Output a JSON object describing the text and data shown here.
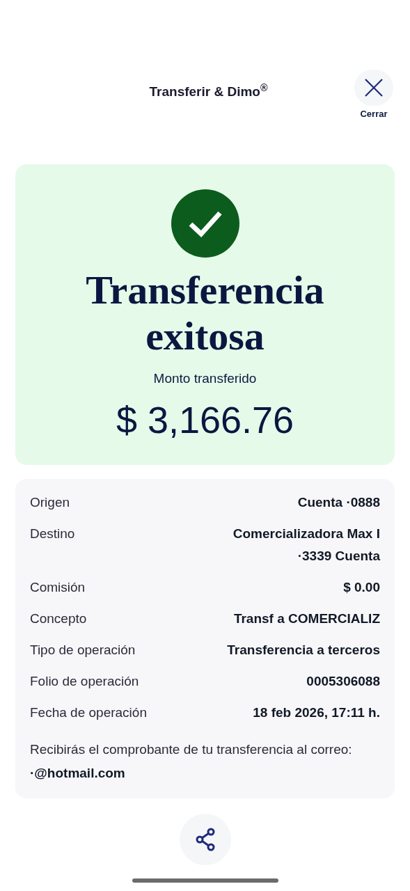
{
  "header": {
    "title": "Transferir & Dimo$^{®}$",
    "close_label": "Cerrar"
  },
  "result": {
    "title": "Transferencia exitosa",
    "amount_label": "Monto transferido",
    "amount": "$ 3,166.76"
  },
  "details": [
    {
      "label": "Origen",
      "value": "Cuenta ·0888"
    },
    {
      "label": "Destino",
      "value": "Comercializadora Max I ·3339 Cuenta"
    },
    {
      "label": "Comisión",
      "value": "$ 0.00"
    },
    {
      "label": "Concepto",
      "value": "Transf a COMERCIALIZ"
    },
    {
      "label": "Tipo de operación",
      "value": "Transferencia a terceros"
    },
    {
      "label": "Folio de operación",
      "value": "0005306088"
    },
    {
      "label": "Fecha de operación",
      "value": "18 feb 2026, 17:11 h."
    }
  ],
  "notice": {
    "text": "Recibirás el comprobante de tu transferencia al correo:",
    "email": "·@hotmail.com"
  }
}
